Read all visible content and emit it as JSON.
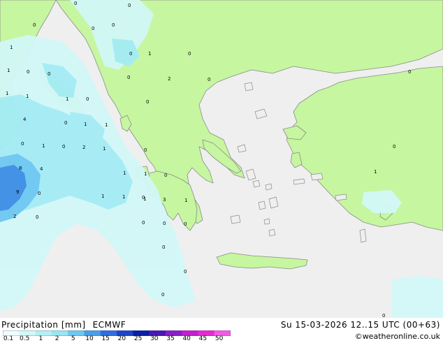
{
  "colors": {
    "sea": "#efefef",
    "land": "#c6f6a0",
    "coast": "#888888",
    "precip_light": "#d2f8f8",
    "precip_mid": "#a4ecf6",
    "precip_heavy": "#6cc8f2",
    "precip_max": "#3a8ee6"
  },
  "footer": {
    "title": "Precipitation [mm]",
    "model": "ECMWF",
    "datetime": "Su 15-03-2026 12..15 UTC (00+63)",
    "credit": "©weatheronline.co.uk"
  },
  "legend": {
    "labels": [
      "0.1",
      "0.5",
      "1",
      "2",
      "5",
      "10",
      "15",
      "20",
      "25",
      "30",
      "35",
      "40",
      "45",
      "50"
    ],
    "colors": [
      "#f0fdfd",
      "#d2f8f8",
      "#b4f0f6",
      "#96e6f4",
      "#6cc8f2",
      "#4a9ee8",
      "#2f6ee0",
      "#1c44c8",
      "#0a1ea8",
      "#4a16b4",
      "#8a1ec8",
      "#c21ed2",
      "#e62ad2",
      "#f25ae6"
    ]
  },
  "map_values": {
    "v1": "0",
    "v2": "0",
    "v3": "0",
    "v4": "0",
    "v5": "0",
    "v6": "1",
    "v7": "1",
    "v8": "0",
    "v9": "0",
    "v10": "0",
    "v11": "1",
    "v12": "0",
    "v13": "0",
    "v14": "2",
    "v15": "0",
    "v16": "1",
    "v17": "1",
    "v18": "0",
    "v19": "0",
    "v20": "1",
    "v21": "4",
    "v22": "0",
    "v23": "1",
    "v24": "1",
    "v25": "0",
    "v26": "1",
    "v27": "0",
    "v28": "2",
    "v29": "1",
    "v30": "0",
    "v31": "8",
    "v32": "4",
    "v33": "1",
    "v34": "1",
    "v35": "0",
    "v36": "9",
    "v37": "0",
    "v38": "1",
    "v39": "1",
    "v40": "0",
    "v41": "1",
    "v42": "3",
    "v43": "1",
    "v44": "2",
    "v45": "0",
    "v46": "0",
    "v47": "0",
    "v48": "0",
    "v49": "0",
    "v50": "0",
    "v51": "0",
    "v52": "1",
    "v53": "0",
    "v54": "0",
    "v55": "0"
  }
}
